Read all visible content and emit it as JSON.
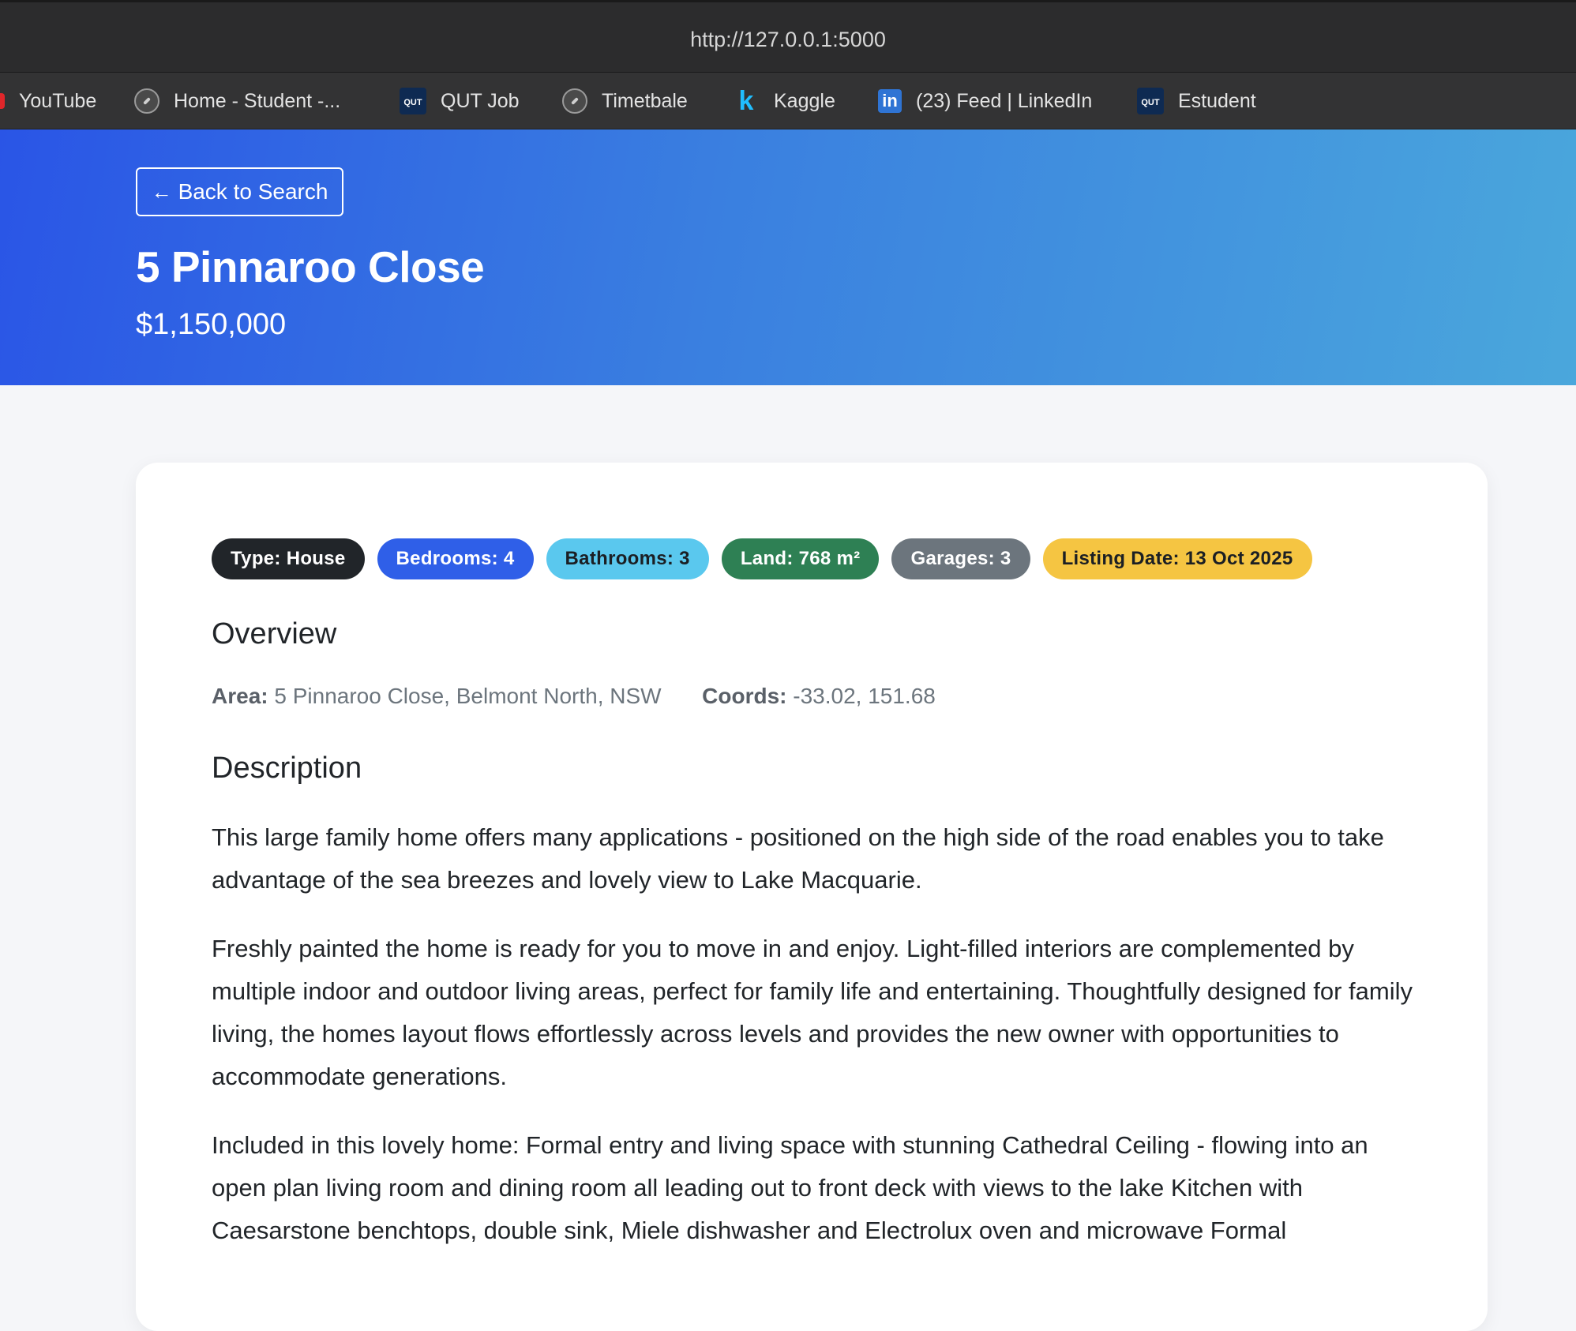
{
  "browser": {
    "url": "http://127.0.0.1:5000",
    "bookmarks": [
      {
        "label": "YouTube",
        "icon": "youtube-icon"
      },
      {
        "label": "Home - Student -...",
        "icon": "compass-icon"
      },
      {
        "label": "QUT Job",
        "icon": "qut-icon"
      },
      {
        "label": "Timetbale",
        "icon": "compass-icon"
      },
      {
        "label": "Kaggle",
        "icon": "kaggle-icon"
      },
      {
        "label": "(23) Feed | LinkedIn",
        "icon": "linkedin-icon"
      },
      {
        "label": "Estudent",
        "icon": "qut-icon"
      }
    ],
    "qut_icon_text": "QUT",
    "kaggle_icon_text": "k",
    "linkedin_icon_text": "in"
  },
  "hero": {
    "back_label": "Back to Search",
    "back_arrow": "←",
    "title": "5 Pinnaroo Close",
    "price": "$1,150,000"
  },
  "badges": [
    {
      "label": "Type: House",
      "bg": "#212529",
      "fg": "#ffffff"
    },
    {
      "label": "Bedrooms: 4",
      "bg": "#2f5fe8",
      "fg": "#ffffff"
    },
    {
      "label": "Bathrooms: 3",
      "bg": "#5ac8ee",
      "fg": "#1b1f24"
    },
    {
      "label": "Land: 768 m²",
      "bg": "#2e8054",
      "fg": "#ffffff"
    },
    {
      "label": "Garages: 3",
      "bg": "#6c757d",
      "fg": "#ffffff"
    },
    {
      "label": "Listing Date: 13 Oct 2025",
      "bg": "#f5c542",
      "fg": "#1b1f24"
    }
  ],
  "overview": {
    "heading": "Overview",
    "area_label": "Area:",
    "area_value": "5 Pinnaroo Close, Belmont North, NSW",
    "coords_label": "Coords:",
    "coords_value": "-33.02, 151.68"
  },
  "description": {
    "heading": "Description",
    "paragraphs": [
      "This large family home offers many applications - positioned on the high side of the road enables you to take advantage of the sea breezes and lovely view to Lake Macquarie.",
      "Freshly painted the home is ready for you to move in and enjoy. Light-filled interiors are complemented by multiple indoor and outdoor living areas, perfect for family life and entertaining. Thoughtfully designed for family living, the homes layout flows effortlessly across levels and provides the new owner with opportunities to accommodate generations.",
      "Included in this lovely home: Formal entry and living space with stunning Cathedral Ceiling - flowing into an open plan living room and dining room all leading out to front deck with views to the lake Kitchen with Caesarstone benchtops, double sink, Miele dishwasher and Electrolux oven and microwave Formal"
    ]
  }
}
